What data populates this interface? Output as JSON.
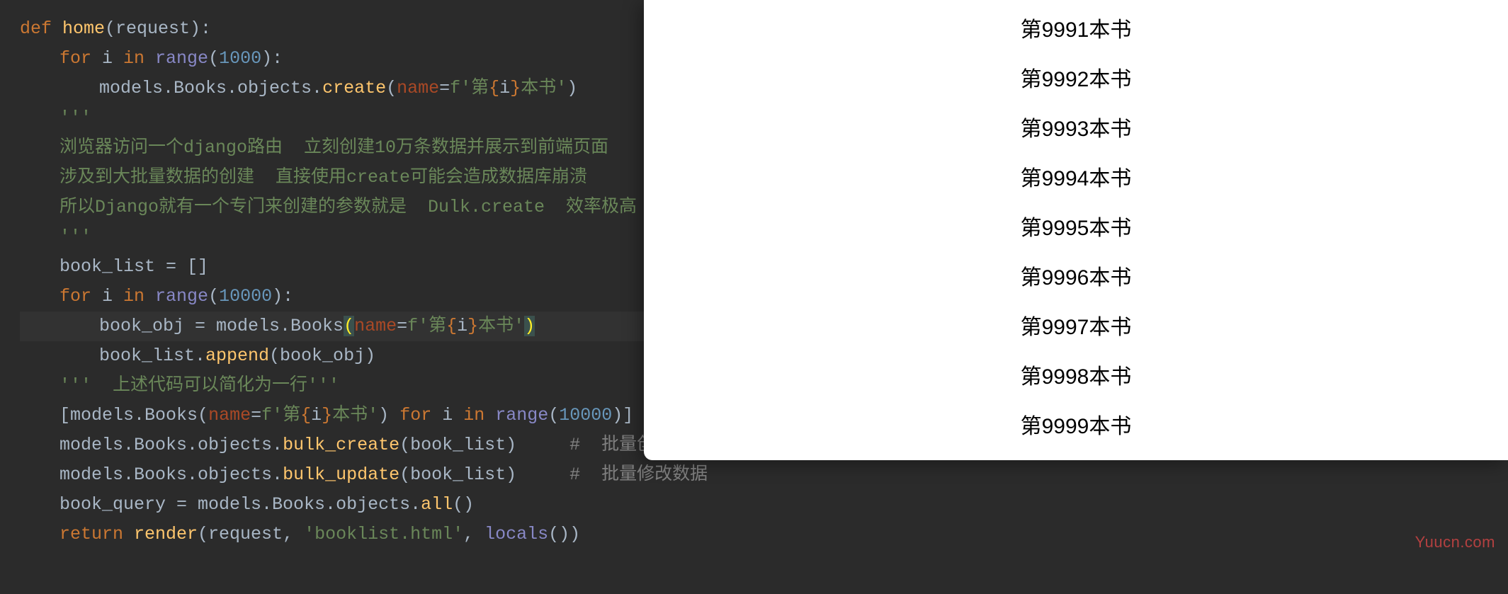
{
  "code": {
    "l1_def": "def ",
    "l1_fn": "home",
    "l1_rest": "(request):",
    "l2_for": "for ",
    "l2_var": "i ",
    "l2_in": "in ",
    "l2_range": "range",
    "l2_open": "(",
    "l2_num": "1000",
    "l2_close": "):",
    "l3_a": "models.Books.objects.",
    "l3_create": "create",
    "l3_open": "(",
    "l3_name": "name",
    "l3_eq": "=",
    "l3_f": "f'第",
    "l3_br_o": "{",
    "l3_i": "i",
    "l3_br_c": "}",
    "l3_end": "本书'",
    "l3_close": ")",
    "l4": "'''",
    "l5": "浏览器访问一个django路由  立刻创建10万条数据并展示到前端页面",
    "l6": "涉及到大批量数据的创建  直接使用create可能会造成数据库崩溃",
    "l7": "所以Django就有一个专门来创建的参数就是  Dulk.create  效率极高  还有  Dulk.update",
    "l8": "'''",
    "l9_a": "book_list = ",
    "l9_b": "[]",
    "l10_for": "for ",
    "l10_var": "i ",
    "l10_in": "in ",
    "l10_range": "range",
    "l10_open": "(",
    "l10_num": "10000",
    "l10_close": "):",
    "l11_a": "book_obj = models.",
    "l11_books": "Books",
    "l11_op": "(",
    "l11_name": "name",
    "l11_eq": "=",
    "l11_f": "f'第",
    "l11_br_o": "{",
    "l11_i": "i",
    "l11_br_c": "}",
    "l11_end": "本书'",
    "l11_cl": ")",
    "l12_a": "book_list.",
    "l12_append": "append",
    "l12_b": "(book_obj)",
    "l13": "'''  上述代码可以简化为一行'''",
    "l14_a": "[models.",
    "l14_books": "Books",
    "l14_op": "(",
    "l14_name": "name",
    "l14_eq": "=",
    "l14_f": "f'第",
    "l14_br_o": "{",
    "l14_i": "i",
    "l14_br_c": "}",
    "l14_end": "本书'",
    "l14_cl": ") ",
    "l14_for": "for ",
    "l14_var": "i ",
    "l14_in": "in ",
    "l14_range": "range",
    "l14_op2": "(",
    "l14_num": "10000",
    "l14_cl2": ")]",
    "l15_a": "models.Books.objects.",
    "l15_fn": "bulk_create",
    "l15_b": "(book_list)",
    "l15_c": "     #  批量创建数据",
    "l16_a": "models.Books.objects.",
    "l16_fn": "bulk_update",
    "l16_b": "(book_list)",
    "l16_c": "     #  批量修改数据",
    "l17_a": "book_query = models.Books.objects.",
    "l17_fn": "all",
    "l17_b": "()",
    "l18_ret": "return ",
    "l18_render": "render",
    "l18_a": "(request, ",
    "l18_str": "'booklist.html'",
    "l18_b": ", ",
    "l18_locals": "locals",
    "l18_c": "())"
  },
  "browser": {
    "items": [
      "第9991本书",
      "第9992本书",
      "第9993本书",
      "第9994本书",
      "第9995本书",
      "第9996本书",
      "第9997本书",
      "第9998本书",
      "第9999本书"
    ]
  },
  "watermark": "Yuucn.com"
}
